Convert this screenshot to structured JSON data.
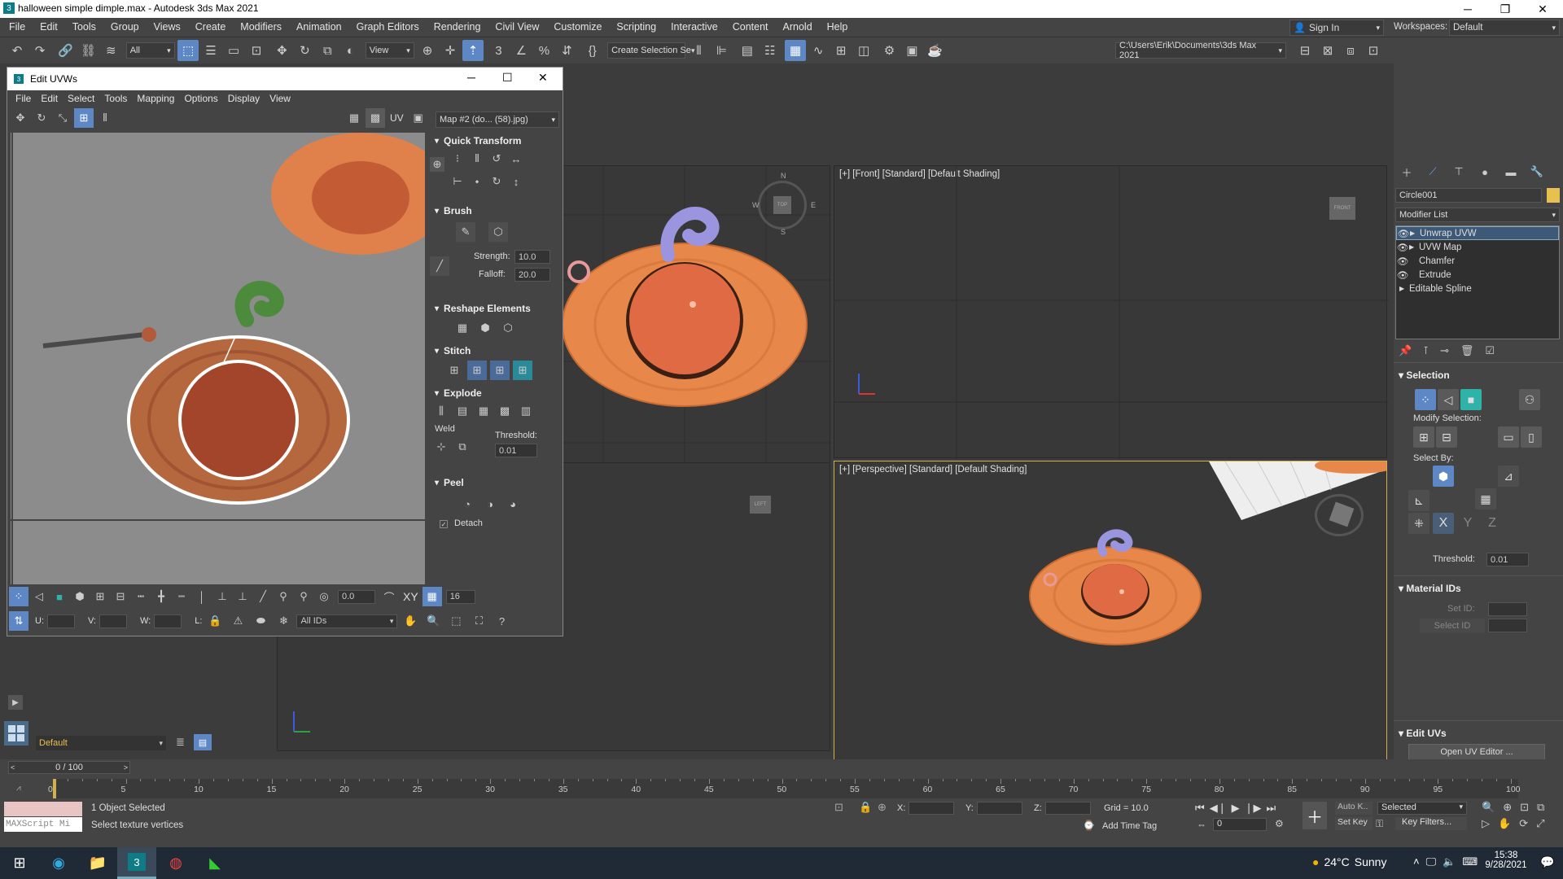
{
  "window": {
    "title": "halloween simple dimple.max - Autodesk 3ds Max 2021"
  },
  "menu": [
    "File",
    "Edit",
    "Tools",
    "Group",
    "Views",
    "Create",
    "Modifiers",
    "Animation",
    "Graph Editors",
    "Rendering",
    "Civil View",
    "Customize",
    "Scripting",
    "Interactive",
    "Content",
    "Arnold",
    "Help"
  ],
  "account": {
    "sign_in": "Sign In",
    "workspaces_label": "Workspaces:",
    "workspace": "Default"
  },
  "toolbar": {
    "filter": "All",
    "ref_coord": "View",
    "selection_set": "Create Selection Se",
    "project_path": "C:\\Users\\Erik\\Documents\\3ds Max 2021"
  },
  "viewports": {
    "front": "[+] [Front] [Standard] [Default Shading]",
    "perspective": "[+] [Perspective] [Standard] [Default Shading]",
    "top_cube": "TOP",
    "front_cube": "FRONT",
    "left_cube": "LEFT",
    "compass": {
      "n": "N",
      "s": "S",
      "e": "E",
      "w": "W"
    }
  },
  "command_panel": {
    "object_name": "Circle001",
    "modifier_list": "Modifier List",
    "modifiers": [
      "Unwrap UVW",
      "UVW Map",
      "Chamfer",
      "Extrude",
      "Editable Spline"
    ],
    "selection": {
      "header": "Selection",
      "modify_selection": "Modify Selection:",
      "select_by": "Select By:",
      "threshold_label": "Threshold:",
      "threshold": "0.01",
      "axes": [
        "X",
        "Y",
        "Z"
      ]
    },
    "material_ids": {
      "header": "Material IDs",
      "set_id": "Set ID:",
      "select_id": "Select ID"
    },
    "edit_uvs": {
      "header": "Edit UVs",
      "open_editor": "Open UV Editor ..."
    }
  },
  "uvw": {
    "title": "Edit UVWs",
    "menu": [
      "File",
      "Edit",
      "Select",
      "Tools",
      "Mapping",
      "Options",
      "Display",
      "View"
    ],
    "uv_label": "UV",
    "map": "Map #2 (do... (58).jpg)",
    "rollouts": {
      "quick_transform": "Quick Transform",
      "brush": "Brush",
      "strength_label": "Strength:",
      "strength": "10.0",
      "falloff_label": "Falloff:",
      "falloff": "20.0",
      "reshape": "Reshape Elements",
      "stitch": "Stitch",
      "explode": "Explode",
      "weld": "Weld",
      "threshold_label": "Threshold:",
      "threshold": "0.01",
      "peel": "Peel",
      "detach": "Detach"
    },
    "bottom": {
      "rotate_value": "0.0",
      "xy": "XY",
      "grid_value": "16",
      "u_label": "U:",
      "v_label": "V:",
      "w_label": "W:",
      "l_label": "L:",
      "ids": "All IDs"
    }
  },
  "layer": {
    "name": "Default"
  },
  "timeline": {
    "frame": "0 / 100",
    "ticks": [
      "0",
      "5",
      "10",
      "15",
      "20",
      "25",
      "30",
      "35",
      "40",
      "45",
      "50",
      "55",
      "60",
      "65",
      "70",
      "75",
      "80",
      "85",
      "90",
      "95",
      "100"
    ]
  },
  "status": {
    "maxscript": "MAXScript Mi",
    "objects": "1 Object Selected",
    "prompt": "Select texture vertices",
    "x_label": "X:",
    "y_label": "Y:",
    "z_label": "Z:",
    "grid": "Grid = 10.0",
    "add_time_tag": "Add Time Tag",
    "auto_key": "Auto K..",
    "set_key": "Set Key",
    "key_mode": "Selected",
    "key_filters": "Key Filters...",
    "frame_field": "0"
  },
  "taskbar": {
    "weather_temp": "24°C",
    "weather": "Sunny",
    "time": "15:38",
    "date": "9/28/2021"
  },
  "colors": {
    "accent": "#5d88c5",
    "pumpkin": "#e8874a",
    "stem_purple": "#9b95e0",
    "viewport_active_border": "#d2b04a"
  }
}
